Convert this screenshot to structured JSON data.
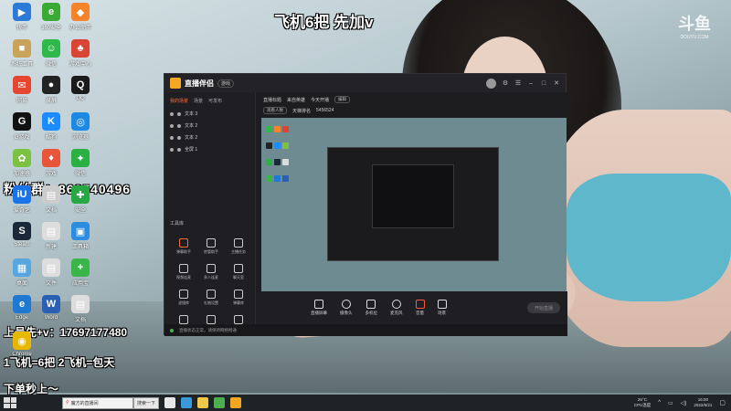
{
  "overlays": {
    "top_text": "飞机6把 先加v",
    "fans_group": "粉丝群：868540496",
    "contact": "上号先+v：17697177480",
    "price": "1飞机=6把 2飞机=包天",
    "order": "下单秒上～",
    "watermark": "斗鱼",
    "watermark_sub": "DOUYU.COM"
  },
  "desktop_icons": [
    {
      "label": "快手",
      "color": "#2b7bd6",
      "glyph": "▶"
    },
    {
      "label": "360安全",
      "color": "#3aa935",
      "glyph": "e"
    },
    {
      "label": "办公助手",
      "color": "#f4832a",
      "glyph": "◆"
    },
    {
      "label": "系统工具",
      "color": "#c9a35a",
      "glyph": "■"
    },
    {
      "label": "微信",
      "color": "#2fb94a",
      "glyph": "☺"
    },
    {
      "label": "游戏中心",
      "color": "#d94434",
      "glyph": "♣"
    },
    {
      "label": "网易",
      "color": "#e6462f",
      "glyph": "✉"
    },
    {
      "label": "录屏",
      "color": "#222222",
      "glyph": "●"
    },
    {
      "label": "QQ",
      "color": "#1b1b1b",
      "glyph": "Q"
    },
    {
      "label": "G游戏",
      "color": "#111111",
      "glyph": "G"
    },
    {
      "label": "酷狗",
      "color": "#1a8cff",
      "glyph": "K"
    },
    {
      "label": "浏览器",
      "color": "#1e88e5",
      "glyph": "◎"
    },
    {
      "label": "加速器",
      "color": "#7cc242",
      "glyph": "✿"
    },
    {
      "label": "游戏",
      "color": "#e8553a",
      "glyph": "♦"
    },
    {
      "label": "微信",
      "color": "#2ab043",
      "glyph": "✦"
    },
    {
      "label": "爱奇艺",
      "color": "#1a73e8",
      "glyph": "iU"
    },
    {
      "label": "文档",
      "color": "#cccccc",
      "glyph": "▤"
    },
    {
      "label": "安全",
      "color": "#27a844",
      "glyph": "✚"
    },
    {
      "label": "Steam",
      "color": "#1b2838",
      "glyph": "S"
    },
    {
      "label": "新建",
      "color": "#dddddd",
      "glyph": "▤"
    },
    {
      "label": "工具箱",
      "color": "#2c8cdf",
      "glyph": "▣"
    },
    {
      "label": "桌面",
      "color": "#58a6e0",
      "glyph": "▦"
    },
    {
      "label": "文件",
      "color": "#dddddd",
      "glyph": "▤"
    },
    {
      "label": "应用宝",
      "color": "#39b54a",
      "glyph": "+"
    },
    {
      "label": "Edge",
      "color": "#1f78d1",
      "glyph": "e"
    },
    {
      "label": "Word",
      "color": "#2b5fb5",
      "glyph": "W"
    },
    {
      "label": "文档",
      "color": "#dddddd",
      "glyph": "▤"
    },
    {
      "label": "Chrome",
      "color": "#e6b800",
      "glyph": "◉"
    }
  ],
  "app": {
    "name": "直播伴侣",
    "badge": "游戏",
    "left_tabs": [
      "我的场景",
      "场景",
      "可发布"
    ],
    "sources": [
      "文本 3",
      "文本 2",
      "文本 2",
      "全屏 1"
    ],
    "tools_title": "工具库",
    "tools": [
      "弹幕助手",
      "房管助手",
      "主播任务",
      "视频连麦",
      "多人连麦",
      "聊天室",
      "滤镜库",
      "礼物设置",
      "弹幕库",
      "分享",
      "热门",
      "下载"
    ],
    "top_row_1": [
      "直播标题",
      "来自英雄",
      "今天开播",
      "编辑"
    ],
    "top_row_2": [
      "观看人数",
      "天梯排名",
      "5456524"
    ],
    "bottom_buttons": [
      "直播屏幕",
      "摄像头",
      "多机位",
      "麦克风",
      "音量",
      "场景"
    ],
    "live_button": "开始直播",
    "status_text": "直播状态正常，请保持网络畅通"
  },
  "taskbar": {
    "search_text": "魔方的直播间",
    "search_button": "搜索一下",
    "weather": "26°C",
    "weather_desc": "CPU温度",
    "time": "16:00",
    "date": "2022/6/21"
  }
}
